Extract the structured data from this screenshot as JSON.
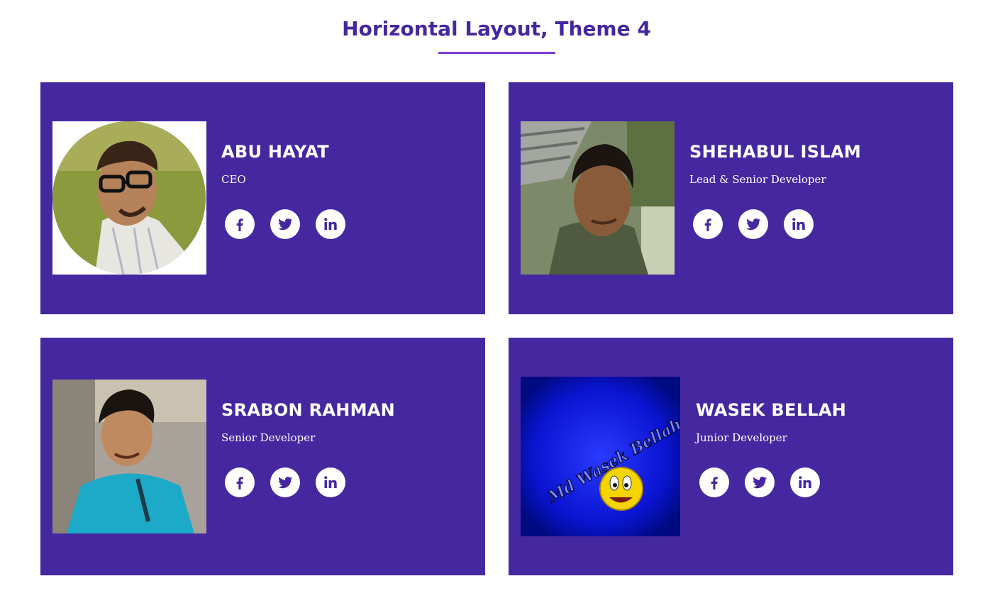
{
  "page": {
    "title": "Horizontal Layout, Theme 4"
  },
  "colors": {
    "card_bg": "#4527a0",
    "title": "#45279f",
    "underline": "#7b3fd0",
    "icon": "#4527a0"
  },
  "members": [
    {
      "name": "ABU HAYAT",
      "role": "CEO",
      "socials": [
        "facebook-icon",
        "twitter-icon",
        "linkedin-icon"
      ]
    },
    {
      "name": "SHEHABUL ISLAM",
      "role": "Lead & Senior Developer",
      "socials": [
        "facebook-icon",
        "twitter-icon",
        "linkedin-icon"
      ]
    },
    {
      "name": "SRABON RAHMAN",
      "role": "Senior Developer",
      "socials": [
        "facebook-icon",
        "twitter-icon",
        "linkedin-icon"
      ]
    },
    {
      "name": "WASEK BELLAH",
      "role": "Junior Developer",
      "photo_text": "Md Wasek Bellah",
      "socials": [
        "facebook-icon",
        "twitter-icon",
        "linkedin-icon"
      ]
    }
  ]
}
